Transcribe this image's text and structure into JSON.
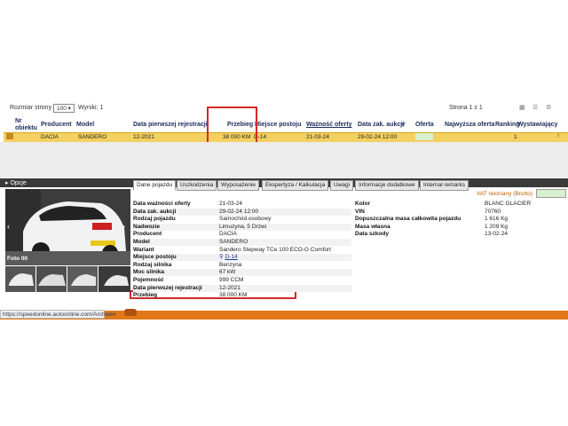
{
  "toolbar": {
    "page_size_label": "Rozmiar strony",
    "page_size_value": "100",
    "results": "Wyniki: 1",
    "page_indicator": "Strona 1 z 1"
  },
  "table": {
    "headers": {
      "nr": "Nr obiektu",
      "producent": "Producent",
      "model": "Model",
      "data_rej": "Data pierwszej rejestracji",
      "przebieg": "Przebieg",
      "miejsce": "Miejsce postoju",
      "waznosc": "Ważność oferty",
      "data_zak": "Data zak. aukcji",
      "oferta": "Oferta",
      "najwyzsza": "Najwyższa oferta",
      "ranking": "Ranking",
      "wystawiajacy": "Wystawiający"
    },
    "row": {
      "producent": "DACIA",
      "model": "SANDERO",
      "data_rej": "12-2021",
      "przebieg": "38 000 KM",
      "miejsce": "D-14",
      "waznosc": "21-03-24",
      "data_zak": "29-02-24 12:00",
      "ranking": "1"
    }
  },
  "options_label": "Opcje",
  "tabs": [
    {
      "label": "Dane pojazdu"
    },
    {
      "label": "Uszkodzenia"
    },
    {
      "label": "Wyposażenie"
    },
    {
      "label": "Ekspertyza / Kalkulacja"
    },
    {
      "label": "Uwagi"
    },
    {
      "label": "Informacje dodatkowe"
    },
    {
      "label": "Internal remarks"
    }
  ],
  "vat_label": "VAT nieznany (Brutto)",
  "photo_label": "Foto 00",
  "details_left": [
    {
      "label": "Data ważności oferty",
      "value": "21-03-24"
    },
    {
      "label": "Data zak. aukcji",
      "value": "29-02-24 12:00"
    },
    {
      "label": "Rodzaj pojazdu",
      "value": "Samochód osobowy"
    },
    {
      "label": "Nadwozie",
      "value": "Limuzyna, 5 Drzwi"
    },
    {
      "label": "Producent",
      "value": "DACIA"
    },
    {
      "label": "Model",
      "value": "SANDERO"
    },
    {
      "label": "Wariant",
      "value": "Sandero Stepway TCe 100 ECO-G Comfort"
    },
    {
      "label": "Miejsce postoju",
      "value": "D-14"
    },
    {
      "label": "Rodzaj silnika",
      "value": "Benzyna"
    },
    {
      "label": "Moc silnika",
      "value": "67 kW"
    },
    {
      "label": "Pojemność",
      "value": "999 CCM"
    },
    {
      "label": "Data pierwszej rejestracji",
      "value": "12-2021"
    },
    {
      "label": "Przebieg",
      "value": "38 000 KM"
    }
  ],
  "details_right": [
    {
      "label": "Kolor",
      "value": "BLANC GLACIER"
    },
    {
      "label": "VIN",
      "value": "70760"
    },
    {
      "label": "Dopuszczalna masa całkowita pojazdu",
      "value": "1 616 Kg"
    },
    {
      "label": "Masa własna",
      "value": "1 209 Kg"
    },
    {
      "label": "Data szkody",
      "value": "13-02-24"
    }
  ],
  "status_url": "https://speedonline.autoonline.com/Archive#"
}
